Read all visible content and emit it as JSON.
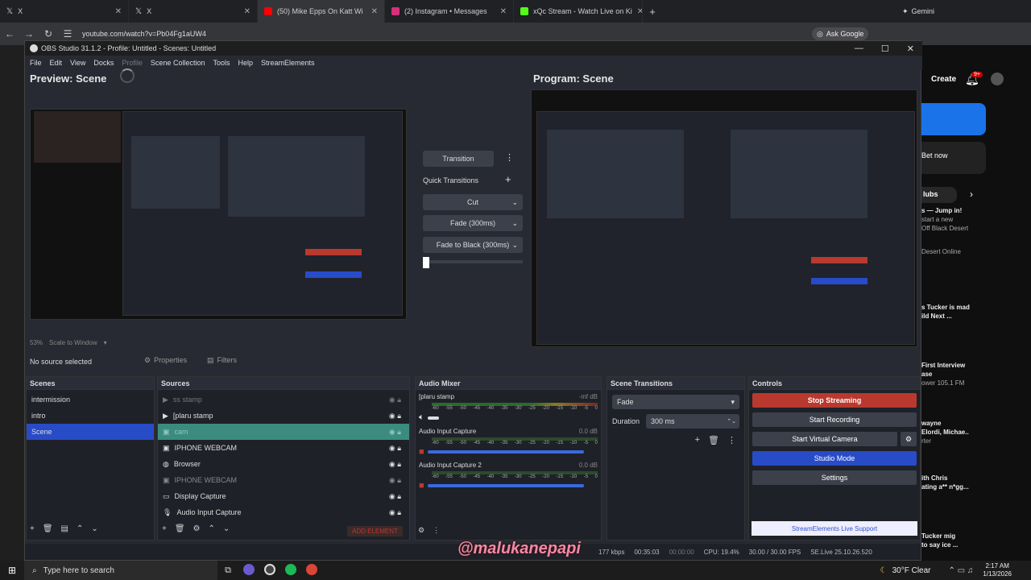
{
  "browser": {
    "tabs": [
      {
        "label": "X",
        "icon": "x-icon"
      },
      {
        "label": "X",
        "icon": "x-icon"
      },
      {
        "label": "(50) Mike Epps On Katt Wi",
        "icon": "youtube-icon"
      },
      {
        "label": "(2) Instagram • Messages",
        "icon": "instagram-icon"
      },
      {
        "label": "xQc Stream - Watch Live on Ki",
        "icon": "kick-icon"
      }
    ],
    "gemini_label": "Gemini",
    "url": "youtube.com/watch?v=Pb04Fg1aUW4",
    "ask_google": "Ask Google"
  },
  "youtube": {
    "create": "Create",
    "badge": "9+",
    "bet_now": "Bet now",
    "clubs": "lubs",
    "items": [
      {
        "title": "s — Jump in!",
        "sub1": "start a new",
        "sub2": "Off Black Desert"
      },
      {
        "title": "Desert Online"
      },
      {
        "title": "s Tucker is mad",
        "sub1": "ild Next ..."
      },
      {
        "title": "First Interview",
        "sub1": "ase",
        "sub2": "ower 105.1 FM"
      },
      {
        "title": "wayne",
        "sub1": "Elordi, Michae..",
        "sub2": "rter"
      },
      {
        "title": "ith Chris",
        "sub1": "ating a** n*gg..."
      },
      {
        "title": "Tucker mig",
        "sub1": "to say ice ..."
      }
    ]
  },
  "obs": {
    "title": "OBS Studio 31.1.2 - Profile: Untitled - Scenes: Untitled",
    "menu": [
      "File",
      "Edit",
      "View",
      "Docks",
      "Profile",
      "Scene Collection",
      "Tools",
      "Help",
      "StreamElements"
    ],
    "preview_title": "Preview: Scene",
    "program_title": "Program: Scene",
    "zoom": "53%",
    "scale": "Scale to Window",
    "transition_btn": "Transition",
    "quick_transitions": "Quick Transitions",
    "quick_items": [
      "Cut",
      "Fade (300ms)",
      "Fade to Black (300ms)"
    ],
    "no_source": "No source selected",
    "properties": "Properties",
    "filters": "Filters",
    "scenes_title": "Scenes",
    "scenes": [
      "intermission",
      "intro",
      "Scene"
    ],
    "sources_title": "Sources",
    "sources": [
      "ss stamp",
      "[plaru stamp",
      "cam",
      "IPHONE WEBCAM",
      "Browser",
      "IPHONE WEBCAM",
      "Display Capture",
      "Audio Input Capture"
    ],
    "add_element": "ADD ELEMENT",
    "mixer_title": "Audio Mixer",
    "mixer": [
      {
        "name": "[plaru stamp",
        "db": "-inf dB"
      },
      {
        "name": "Audio Input Capture",
        "db": "0.0 dB"
      },
      {
        "name": "Audio Input Capture 2",
        "db": "0.0 dB"
      }
    ],
    "ticks": [
      "-60",
      "-55",
      "-50",
      "-45",
      "-40",
      "-35",
      "-30",
      "-25",
      "-20",
      "-15",
      "-10",
      "-5",
      "0"
    ],
    "transitions_title": "Scene Transitions",
    "transition_select": "Fade",
    "duration_label": "Duration",
    "duration_value": "300 ms",
    "controls_title": "Controls",
    "controls": [
      "Stop Streaming",
      "Start Recording",
      "Start Virtual Camera",
      "Studio Mode",
      "Settings"
    ],
    "se_support": "StreamElements Live Support",
    "status": {
      "kbps": "177 kbps",
      "stream_time": "00:35:03",
      "rec_time": "00:00:00",
      "cpu": "CPU: 19.4%",
      "fps": "30.00 / 30.00 FPS",
      "se": "SE.Live 25.10.26.520"
    }
  },
  "watermark": "@malukanepapi",
  "taskbar": {
    "search_placeholder": "Type here to search",
    "weather": "30°F  Clear",
    "time": "2:17 AM",
    "date": "1/13/2026"
  },
  "colors": {
    "stop": "#b9392f",
    "studio": "#284bc7",
    "accent_green": "#3b8c7f"
  }
}
